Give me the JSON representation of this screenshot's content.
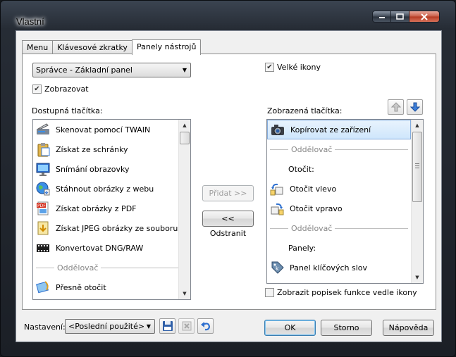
{
  "window": {
    "title": "Vlastní"
  },
  "tabs": [
    {
      "label": "Menu",
      "active": false
    },
    {
      "label": "Klávesové zkratky",
      "active": false
    },
    {
      "label": "Panely nástrojů",
      "active": true
    }
  ],
  "toolbar_select": {
    "value": "Správce - Základní panel"
  },
  "show_checkbox": {
    "label": "Zobrazovat",
    "checked": true
  },
  "large_icons_checkbox": {
    "label": "Velké ikony",
    "checked": true
  },
  "available": {
    "label": "Dostupná tlačítka:",
    "items": [
      {
        "kind": "item",
        "label": "Skenovat pomocí TWAIN",
        "icon": "scanner-icon"
      },
      {
        "kind": "item",
        "label": "Získat ze schránky",
        "icon": "clipboard-icon"
      },
      {
        "kind": "item",
        "label": "Snímání obrazovky",
        "icon": "monitor-icon"
      },
      {
        "kind": "item",
        "label": "Stáhnout obrázky z webu",
        "icon": "globe-icon"
      },
      {
        "kind": "item",
        "label": "Získat obrázky z PDF",
        "icon": "pdf-icon"
      },
      {
        "kind": "item",
        "label": "Získat JPEG obrázky ze souboru",
        "icon": "jpeg-file-icon"
      },
      {
        "kind": "item",
        "label": "Konvertovat DNG/RAW",
        "icon": "film-icon"
      },
      {
        "kind": "separator",
        "label": "Oddělovač"
      },
      {
        "kind": "item",
        "label": "Přesně otočit",
        "icon": "rotate-exact-icon"
      }
    ]
  },
  "shown": {
    "label": "Zobrazená tlačítka:",
    "items": [
      {
        "kind": "item",
        "label": "Kopírovat ze zařízení",
        "icon": "camera-icon",
        "selected": true
      },
      {
        "kind": "separator",
        "label": "Oddělovač"
      },
      {
        "kind": "group",
        "label": "Otočit:"
      },
      {
        "kind": "item",
        "label": "Otočit vlevo",
        "icon": "rotate-left-icon"
      },
      {
        "kind": "item",
        "label": "Otočit vpravo",
        "icon": "rotate-right-icon"
      },
      {
        "kind": "separator",
        "label": "Oddělovač"
      },
      {
        "kind": "group",
        "label": "Panely:"
      },
      {
        "kind": "item",
        "label": "Panel klíčových slov",
        "icon": "keyword-tag-icon"
      }
    ]
  },
  "buttons": {
    "add": "Přidat >>",
    "remove": "<< Odstranit",
    "ok": "OK",
    "cancel": "Storno",
    "help": "Nápověda"
  },
  "show_caption_checkbox": {
    "label": "Zobrazit popisek funkce vedle ikony",
    "checked": false
  },
  "settings": {
    "label": "Nastavení:",
    "value": "<Poslední použité>"
  },
  "colors": {
    "selection": "#cfe6fc",
    "accent": "#3c7fb1"
  }
}
